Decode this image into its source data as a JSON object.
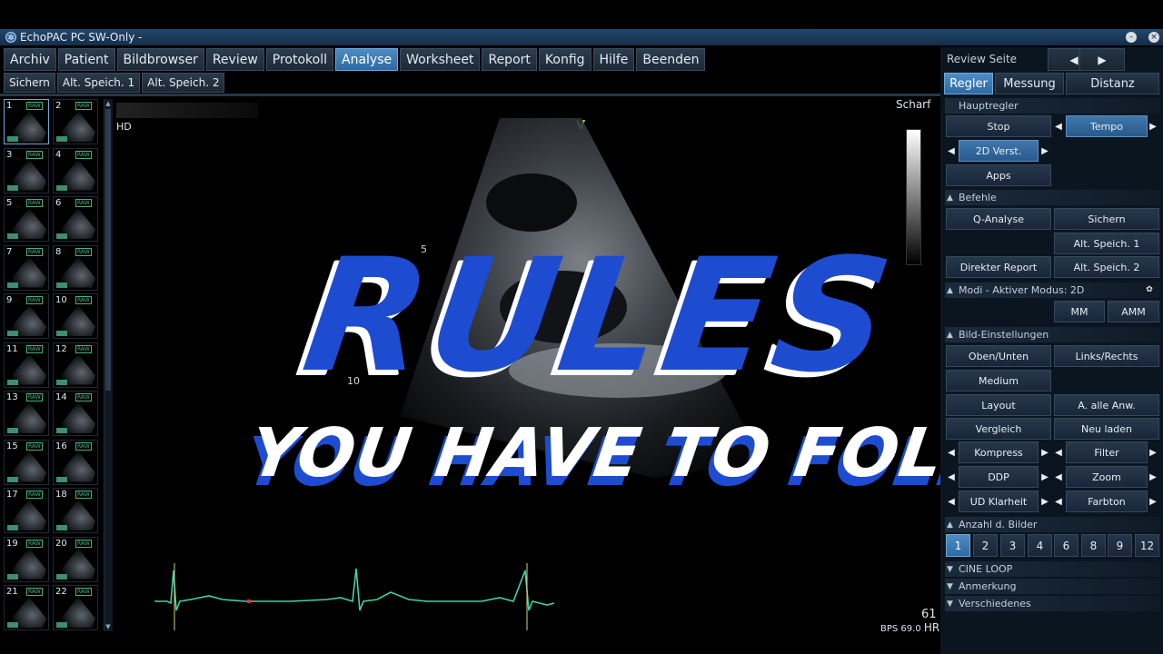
{
  "window": {
    "title": "EchoPAC PC SW-Only -"
  },
  "menu": [
    "Archiv",
    "Patient",
    "Bildbrowser",
    "Review",
    "Protokoll",
    "Analyse",
    "Worksheet",
    "Report",
    "Konfig",
    "Hilfe",
    "Beenden"
  ],
  "menu_active": "Analyse",
  "toolbar": [
    "Sichern",
    "Alt. Speich. 1",
    "Alt. Speich. 2"
  ],
  "thumbnails": [
    "1",
    "2",
    "3",
    "4",
    "5",
    "6",
    "7",
    "8",
    "9",
    "10",
    "11",
    "12",
    "13",
    "14",
    "15",
    "16",
    "17",
    "18",
    "19",
    "20",
    "21",
    "22"
  ],
  "thumbnail_tag": "RAW",
  "image": {
    "hd": "HD",
    "scharf": "Scharf",
    "v_marker": "V",
    "depth_5": "5",
    "depth_10": "10",
    "frame": "61",
    "bps": "BPS 69.0",
    "hr": "HR"
  },
  "overlay": {
    "headline": "RULES",
    "subline": "YOU HAVE TO FOLLOW"
  },
  "right_panel": {
    "review_label": "Review Seite",
    "prev_icon": "◀",
    "next_icon": "▶",
    "tabs": [
      "Regler",
      "Messung",
      "Distanz"
    ],
    "hauptregler": "Hauptregler",
    "stop": "Stop",
    "tempo": "Tempo",
    "verst": "2D Verst.",
    "apps": "Apps",
    "befehle": "Befehle",
    "q_analyse": "Q-Analyse",
    "sichern": "Sichern",
    "alt1": "Alt. Speich. 1",
    "direkter": "Direkter Report",
    "alt2": "Alt. Speich. 2",
    "modi": "Modi - Aktiver Modus: 2D",
    "mm": "MM",
    "amm": "AMM",
    "bild": "Bild-Einstellungen",
    "oben": "Oben/Unten",
    "links": "Links/Rechts",
    "medium": "Medium",
    "layout": "Layout",
    "a_alle": "A. alle Anw.",
    "vergleich": "Vergleich",
    "neu": "Neu laden",
    "kompress": "Kompress",
    "filter": "Filter",
    "ddp": "DDP",
    "zoom": "Zoom",
    "ud": "UD Klarheit",
    "farbton": "Farbton",
    "anzahl": "Anzahl d. Bilder",
    "counts": [
      "1",
      "2",
      "3",
      "4",
      "6",
      "8",
      "9",
      "12"
    ],
    "cine": "CINE LOOP",
    "anmerkung": "Anmerkung",
    "verschiedenes": "Verschiedenes"
  },
  "colors": {
    "accent": "#2d6aa3",
    "headline": "#1e4cd0",
    "ecg": "#3fd1a8"
  }
}
